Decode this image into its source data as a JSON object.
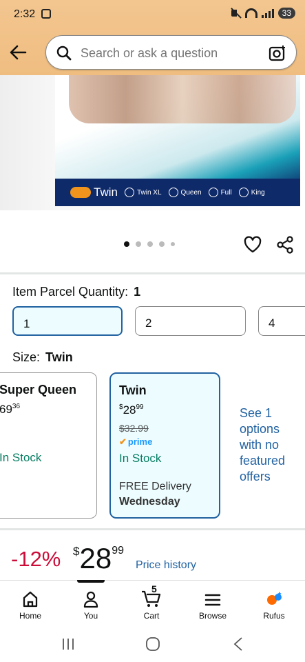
{
  "status_bar": {
    "time": "2:32",
    "battery": "33"
  },
  "search": {
    "placeholder": "Search or ask a question"
  },
  "product_image": {
    "sizes": [
      "Twin",
      "Twin XL",
      "Queen",
      "Full",
      "King"
    ],
    "selected_size": "Twin"
  },
  "carousel": {
    "count": 5,
    "active": 0
  },
  "quantity": {
    "label": "Item Parcel Quantity:",
    "value": "1",
    "options": [
      "1",
      "2",
      "4"
    ]
  },
  "size": {
    "label": "Size:",
    "value": "Twin"
  },
  "cards": [
    {
      "name": "Super Queen",
      "price_whole": "69",
      "price_frac": "36",
      "stock": "In Stock"
    },
    {
      "name": "Twin",
      "currency": "$",
      "price_whole": "28",
      "price_frac": "99",
      "list_price": "$32.99",
      "prime": "prime",
      "stock": "In Stock",
      "delivery": "FREE Delivery",
      "delivery_day": "Wednesday"
    }
  ],
  "see_options": "See 1 options with no featured offers",
  "pricing": {
    "discount": "-12%",
    "currency": "$",
    "whole": "28",
    "fraction": "99",
    "history_link": "Price history"
  },
  "tabs": [
    {
      "label": "Home",
      "icon": "home-icon"
    },
    {
      "label": "You",
      "icon": "person-icon"
    },
    {
      "label": "Cart",
      "icon": "cart-icon",
      "badge": "5"
    },
    {
      "label": "Browse",
      "icon": "menu-icon"
    },
    {
      "label": "Rufus",
      "icon": "rufus-icon"
    }
  ],
  "colors": {
    "header": "#f0c080",
    "link": "#2162a1",
    "deal": "#cc0c39",
    "stock": "#067d62",
    "prime": "#1a98ff"
  }
}
